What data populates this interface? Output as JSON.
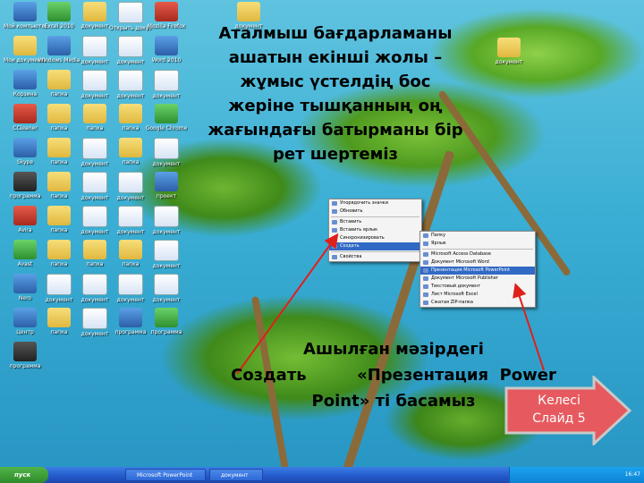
{
  "instruction_top": "Аталмыш бағдарламаны ашатын екінші жолы – жұмыс үстелдің бос жеріне тышқанның оң жағындағы батырманы бір рет шертеміз",
  "instruction_bottom": {
    "line1": "Ашылған мәзірдегі",
    "line2_word1": "Создать",
    "line2_word2": "«Презентация",
    "line2_word3": "Power",
    "line3": "Point» ті   басамыз"
  },
  "next_button": {
    "line1": "Келесі",
    "line2": "Слайд 5"
  },
  "desktop_icons": [
    {
      "label": "Мой компьютер",
      "kind": "app"
    },
    {
      "label": "Excel 2010",
      "kind": "green"
    },
    {
      "label": "документ",
      "kind": "folder"
    },
    {
      "label": "Открыть документ",
      "kind": "doc"
    },
    {
      "label": "Mozilla Firefox",
      "kind": "red"
    },
    {
      "label": "Мои документы",
      "kind": "folder"
    },
    {
      "label": "Windows Media",
      "kind": "app"
    },
    {
      "label": "документ",
      "kind": "doc"
    },
    {
      "label": "документ",
      "kind": "doc"
    },
    {
      "label": "Word 2010",
      "kind": "app"
    },
    {
      "label": "Корзина",
      "kind": "app"
    },
    {
      "label": "папка",
      "kind": "folder"
    },
    {
      "label": "документ",
      "kind": "doc"
    },
    {
      "label": "документ",
      "kind": "doc"
    },
    {
      "label": "документ",
      "kind": "doc"
    },
    {
      "label": "CCleaner",
      "kind": "red"
    },
    {
      "label": "папка",
      "kind": "folder"
    },
    {
      "label": "папка",
      "kind": "folder"
    },
    {
      "label": "папка",
      "kind": "folder"
    },
    {
      "label": "Google Chrome",
      "kind": "green"
    },
    {
      "label": "Skype",
      "kind": "app"
    },
    {
      "label": "папка",
      "kind": "folder"
    },
    {
      "label": "документ",
      "kind": "doc"
    },
    {
      "label": "папка",
      "kind": "folder"
    },
    {
      "label": "документ",
      "kind": "doc"
    },
    {
      "label": "программа",
      "kind": "dark"
    },
    {
      "label": "папка",
      "kind": "folder"
    },
    {
      "label": "документ",
      "kind": "doc"
    },
    {
      "label": "документ",
      "kind": "doc"
    },
    {
      "label": "проект",
      "kind": "app"
    },
    {
      "label": "Avira",
      "kind": "red"
    },
    {
      "label": "папка",
      "kind": "folder"
    },
    {
      "label": "документ",
      "kind": "doc"
    },
    {
      "label": "документ",
      "kind": "doc"
    },
    {
      "label": "документ",
      "kind": "doc"
    },
    {
      "label": "Avast",
      "kind": "green"
    },
    {
      "label": "папка",
      "kind": "folder"
    },
    {
      "label": "папка",
      "kind": "folder"
    },
    {
      "label": "папка",
      "kind": "folder"
    },
    {
      "label": "документ",
      "kind": "doc"
    },
    {
      "label": "Nero",
      "kind": "app"
    },
    {
      "label": "документ",
      "kind": "doc"
    },
    {
      "label": "документ",
      "kind": "doc"
    },
    {
      "label": "документ",
      "kind": "doc"
    },
    {
      "label": "документ",
      "kind": "doc"
    },
    {
      "label": "Центр",
      "kind": "app"
    },
    {
      "label": "папка",
      "kind": "folder"
    },
    {
      "label": "документ",
      "kind": "doc"
    },
    {
      "label": "программа",
      "kind": "app"
    },
    {
      "label": "программа",
      "kind": "green"
    },
    {
      "label": "программа",
      "kind": "dark"
    }
  ],
  "desktop_icons_right": [
    {
      "label": "документ",
      "kind": "folder"
    },
    {
      "label": "документ",
      "kind": "folder"
    }
  ],
  "context_menu": {
    "items": [
      "Упорядочить значки",
      "Обновить",
      "Вставить",
      "Вставить ярлык",
      "Синхронизировать",
      "Создать",
      "Свойства"
    ],
    "highlight_index": 5
  },
  "submenu": {
    "items": [
      "Папку",
      "Ярлык",
      "Microsoft Access Database",
      "Документ Microsoft Word",
      "Презентация Microsoft PowerPoint",
      "Документ Microsoft Publisher",
      "Текстовый документ",
      "Лист Microsoft Excel",
      "Сжатая ZIP-папка"
    ],
    "highlight_index": 4
  },
  "taskbar": {
    "start_label": "пуск",
    "tasks": [
      "Microsoft PowerPoint",
      "документ"
    ],
    "clock": "16:47"
  },
  "colors": {
    "arrow_red": "#e0201a",
    "next_button": "#e65a5f",
    "highlight": "#316ac5"
  }
}
